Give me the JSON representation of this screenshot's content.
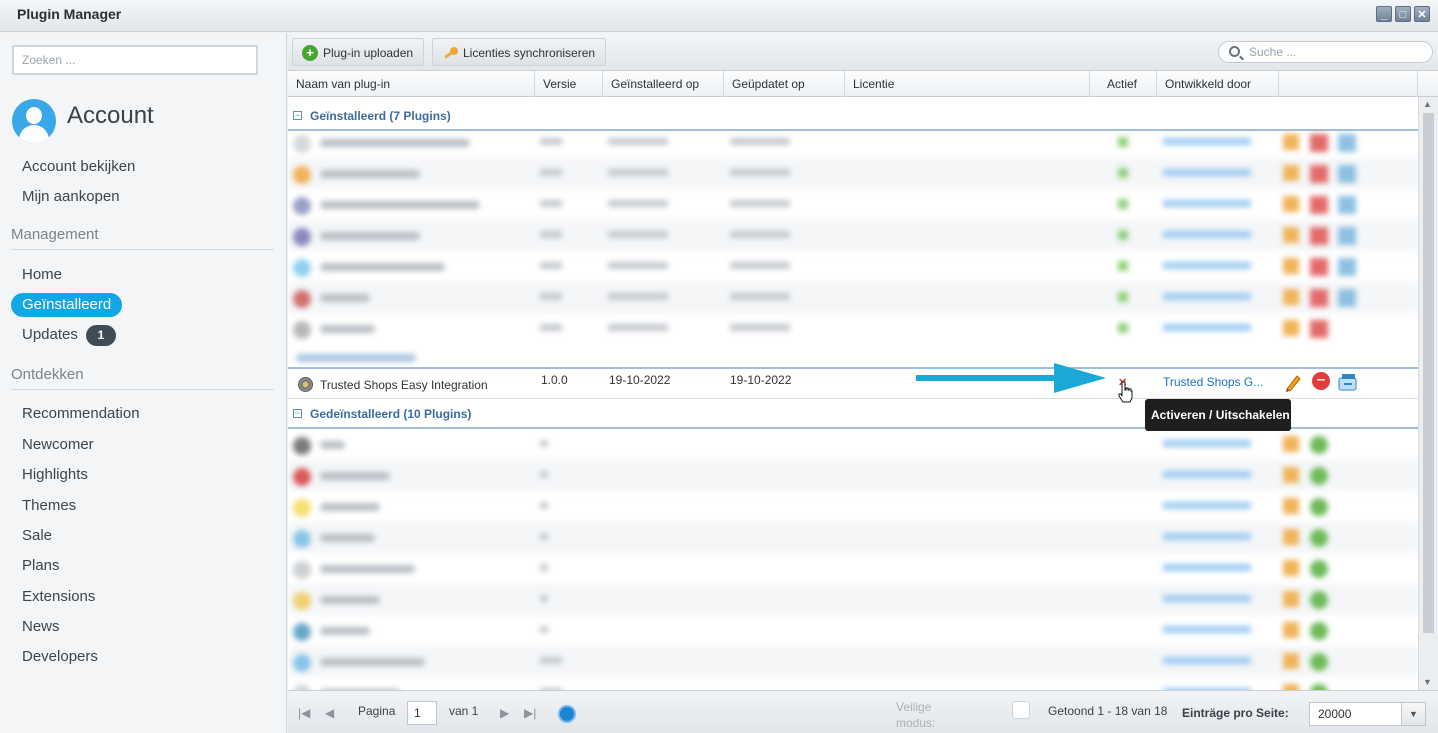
{
  "window": {
    "title": "Plugin Manager",
    "buttons": [
      "_",
      "□",
      "✕"
    ]
  },
  "sidebar": {
    "search_placeholder": "Zoeken ...",
    "account_title": "Account",
    "account_items": [
      "Account bekijken",
      "Mijn aankopen"
    ],
    "management_label": "Management",
    "management_items": {
      "home": "Home",
      "installed": "Geïnstalleerd",
      "updates": "Updates",
      "updates_count": "1"
    },
    "discover_label": "Ontdekken",
    "discover_items": [
      "Recommendation",
      "Newcomer",
      "Highlights",
      "Themes",
      "Sale",
      "Plans",
      "Extensions",
      "News",
      "Developers"
    ]
  },
  "toolbar": {
    "upload_label": "Plug-in uploaden",
    "sync_label": "Licenties synchroniseren",
    "search_placeholder": "Suche ..."
  },
  "columns": {
    "name": "Naam van plug-in",
    "version": "Versie",
    "installed_on": "Geïnstalleerd op",
    "updated_on": "Geüpdatet op",
    "license": "Licentie",
    "active": "Actief",
    "developer": "Ontwikkeld door"
  },
  "groups": {
    "installed": "Geïnstalleerd (7 Plugins)",
    "uninstalled": "Gedeïnstalleerd (10 Plugins)"
  },
  "focus_row": {
    "name": "Trusted Shops Easy Integration",
    "version": "1.0.0",
    "installed_on": "19-10-2022",
    "updated_on": "19-10-2022",
    "active_icon": "✕",
    "developer": "Trusted Shops G..."
  },
  "tooltip": "Activeren / Uitschakelen",
  "pager": {
    "page_label": "Pagina",
    "page_value": "1",
    "of_label": "van 1",
    "safe_mode_label": "Veilige modus:",
    "shown": "Getoond 1 - 18 van 18",
    "per_page_label": "Einträge pro Seite:",
    "per_page_value": "20000"
  },
  "icons": {
    "plus": "plus-icon",
    "key": "key-icon",
    "search": "search-icon",
    "edit": "pencil-icon",
    "uninstall": "minus-circle-icon",
    "reinstall": "reinstall-icon",
    "refresh": "refresh-icon"
  },
  "colors": {
    "accent": "#12a6e4",
    "link": "#1a73c9",
    "group": "#3d6c9c",
    "arrow": "#1aa9d6",
    "danger": "#e23c3c"
  }
}
